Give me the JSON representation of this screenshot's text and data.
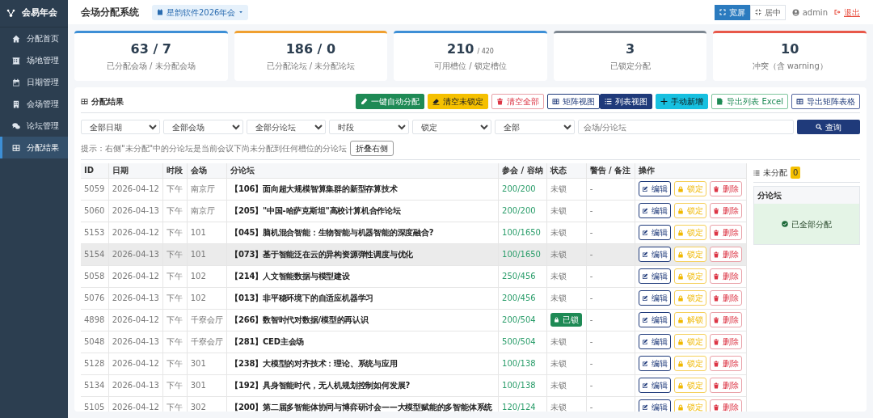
{
  "sidebar": {
    "logo": "会易年会",
    "items": [
      {
        "label": "分配首页",
        "kind": "home",
        "selected": false
      },
      {
        "label": "场地管理",
        "kind": "venue",
        "selected": false
      },
      {
        "label": "日期管理",
        "kind": "date",
        "selected": false
      },
      {
        "label": "会场管理",
        "kind": "hall",
        "selected": false
      },
      {
        "label": "论坛管理",
        "kind": "forum",
        "selected": false
      },
      {
        "label": "分配结果",
        "kind": "result",
        "selected": true
      }
    ]
  },
  "header": {
    "title": "会场分配系统",
    "event": "星韵软件2026年会",
    "layout_buttons": [
      {
        "label": "宽屏",
        "kind": "wide",
        "selected": true
      },
      {
        "label": "居中",
        "kind": "center",
        "selected": false
      }
    ],
    "user": "admin",
    "logout": "退出"
  },
  "stats": [
    {
      "value": "63 / 7",
      "label": "已分配会场 / 未分配会场",
      "color": "#3d8fd6"
    },
    {
      "value": "186 / 0",
      "label": "已分配论坛 / 未分配论坛",
      "color": "#f0a030"
    },
    {
      "value": "210",
      "suffix": "/ 420",
      "label": "可用槽位 / 锁定槽位",
      "color": "#3d8fd6"
    },
    {
      "value": "3",
      "label": "已锁定分配",
      "color": "#7d8791"
    },
    {
      "value": "10",
      "label": "冲突（含 warning）",
      "color": "#e8584a"
    }
  ],
  "results": {
    "title": "分配结果",
    "toolbar": [
      {
        "label": "一键自动分配",
        "kind": "auto"
      },
      {
        "label": "清空未锁定",
        "kind": "clear-unlocked"
      },
      {
        "label": "清空全部",
        "kind": "clear-all"
      },
      {
        "label": "矩阵视图",
        "kind": "view-matrix",
        "selected": false
      },
      {
        "label": "列表视图",
        "kind": "view-list",
        "selected": true
      },
      {
        "label": "手动新增",
        "kind": "add"
      },
      {
        "label": "导出列表 Excel",
        "kind": "export-excel"
      },
      {
        "label": "导出矩阵表格",
        "kind": "export-matrix"
      }
    ],
    "filters": [
      {
        "kind": "select",
        "value": "全部日期"
      },
      {
        "kind": "select",
        "value": "全部会场"
      },
      {
        "kind": "select",
        "value": "全部分论坛"
      },
      {
        "kind": "select",
        "value": "时段"
      },
      {
        "kind": "select",
        "value": "锁定"
      },
      {
        "kind": "select",
        "value": "全部"
      },
      {
        "kind": "input",
        "placeholder": "会场/分论坛"
      }
    ],
    "search_button": "查询",
    "hint": "提示：右侧\"未分配\"中的分论坛是当前会议下尚未分配到任何槽位的分论坛",
    "collapse_button": "折叠右侧",
    "table": {
      "columns": [
        "ID",
        "日期",
        "时段",
        "会场",
        "分论坛",
        "参会 / 容纳",
        "状态",
        "警告 / 备注",
        "操作"
      ],
      "rows": [
        {
          "id": "5059",
          "date": "2026-04-12",
          "slot": "下午",
          "hall": "南京厅",
          "forum": "【106】面向超大规模智算集群的新型存算技术",
          "ratio": "200/200",
          "locked": false,
          "status": "未锁",
          "note": "-",
          "actions": [
            "编辑",
            "锁定",
            "删除"
          ],
          "highlighted": false
        },
        {
          "id": "5060",
          "date": "2026-04-13",
          "slot": "下午",
          "hall": "南京厅",
          "forum": "【205】\"中国-哈萨克斯坦\"高校计算机合作论坛",
          "ratio": "200/200",
          "locked": false,
          "status": "未锁",
          "note": "-",
          "actions": [
            "编辑",
            "锁定",
            "删除"
          ],
          "highlighted": false
        },
        {
          "id": "5153",
          "date": "2026-04-12",
          "slot": "下午",
          "hall": "101",
          "forum": "【045】脑机混合智能：生物智能与机器智能的深度融合?",
          "ratio": "100/1650",
          "locked": false,
          "status": "未锁",
          "note": "-",
          "actions": [
            "编辑",
            "锁定",
            "删除"
          ],
          "highlighted": false
        },
        {
          "id": "5154",
          "date": "2026-04-13",
          "slot": "下午",
          "hall": "101",
          "forum": "【073】基于智能泛在云的异构资源弹性调度与优化",
          "ratio": "100/1650",
          "locked": false,
          "status": "未锁",
          "note": "-",
          "actions": [
            "编辑",
            "锁定",
            "删除"
          ],
          "highlighted": true
        },
        {
          "id": "5058",
          "date": "2026-04-12",
          "slot": "下午",
          "hall": "102",
          "forum": "【214】人文智能数据与模型建设",
          "ratio": "250/456",
          "locked": false,
          "status": "未锁",
          "note": "-",
          "actions": [
            "编辑",
            "锁定",
            "删除"
          ],
          "highlighted": false
        },
        {
          "id": "5076",
          "date": "2026-04-13",
          "slot": "下午",
          "hall": "102",
          "forum": "【013】非平稳环境下的自适应机器学习",
          "ratio": "200/456",
          "locked": false,
          "status": "未锁",
          "note": "-",
          "actions": [
            "编辑",
            "锁定",
            "删除"
          ],
          "highlighted": false
        },
        {
          "id": "4898",
          "date": "2026-04-12",
          "slot": "下午",
          "hall": "千寮会厅",
          "forum": "【266】数智时代对数据/模型的再认识",
          "ratio": "200/504",
          "locked": true,
          "status": "已锁",
          "note": "-",
          "actions": [
            "编辑",
            "解锁",
            "删除"
          ],
          "highlighted": false
        },
        {
          "id": "5048",
          "date": "2026-04-13",
          "slot": "下午",
          "hall": "千寮会厅",
          "forum": "【281】CED主会场",
          "ratio": "500/504",
          "locked": false,
          "status": "未锁",
          "note": "-",
          "actions": [
            "编辑",
            "锁定",
            "删除"
          ],
          "highlighted": false
        },
        {
          "id": "5128",
          "date": "2026-04-12",
          "slot": "下午",
          "hall": "301",
          "forum": "【238】大模型的对齐技术：理论、系统与应用",
          "ratio": "100/138",
          "locked": false,
          "status": "未锁",
          "note": "-",
          "actions": [
            "编辑",
            "锁定",
            "删除"
          ],
          "highlighted": false
        },
        {
          "id": "5134",
          "date": "2026-04-13",
          "slot": "下午",
          "hall": "301",
          "forum": "【192】具身智能时代，无人机规划控制如何发展?",
          "ratio": "100/138",
          "locked": false,
          "status": "未锁",
          "note": "-",
          "actions": [
            "编辑",
            "锁定",
            "删除"
          ],
          "highlighted": false
        },
        {
          "id": "5105",
          "date": "2026-04-12",
          "slot": "下午",
          "hall": "302",
          "forum": "【200】第二届多智能体协同与博弈研讨会——大模型赋能的多智能体系统",
          "ratio": "120/124",
          "locked": false,
          "status": "未锁",
          "note": "-",
          "actions": [
            "编辑",
            "锁定",
            "删除"
          ],
          "highlighted": false
        }
      ]
    },
    "unassigned": {
      "title": "未分配",
      "count": "0",
      "header": "分论坛",
      "message": "已全部分配"
    }
  }
}
